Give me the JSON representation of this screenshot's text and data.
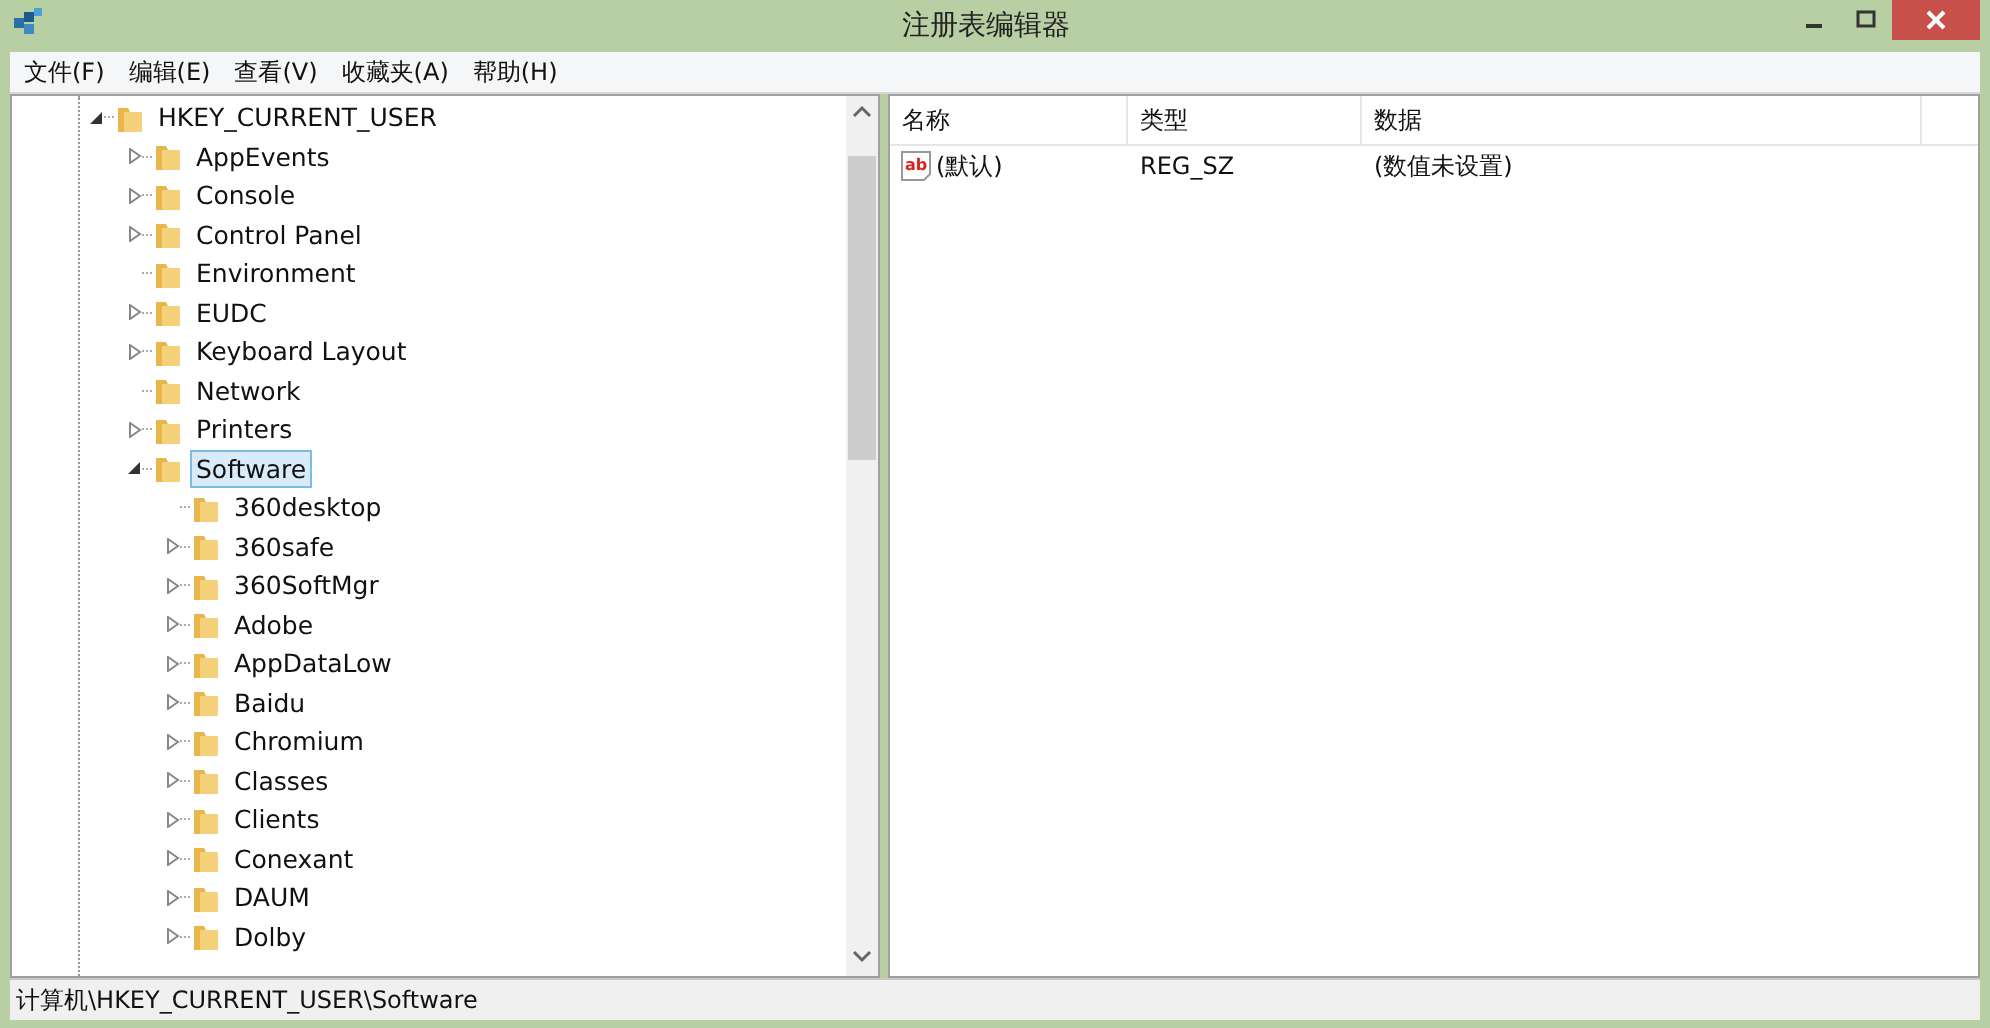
{
  "window": {
    "title": "注册表编辑器"
  },
  "menu": [
    "文件(F)",
    "编辑(E)",
    "查看(V)",
    "收藏夹(A)",
    "帮助(H)"
  ],
  "tree": [
    {
      "label": "HKEY_CURRENT_USER",
      "expanded": true,
      "selected": false,
      "children": [
        {
          "label": "AppEvents",
          "expanded": false,
          "selected": false
        },
        {
          "label": "Console",
          "expanded": false,
          "selected": false
        },
        {
          "label": "Control Panel",
          "expanded": false,
          "selected": false
        },
        {
          "label": "Environment",
          "selected": false
        },
        {
          "label": "EUDC",
          "expanded": false,
          "selected": false
        },
        {
          "label": "Keyboard Layout",
          "expanded": false,
          "selected": false
        },
        {
          "label": "Network",
          "selected": false
        },
        {
          "label": "Printers",
          "expanded": false,
          "selected": false
        },
        {
          "label": "Software",
          "expanded": true,
          "selected": true,
          "children": [
            {
              "label": "360desktop",
              "selected": false
            },
            {
              "label": "360safe",
              "expanded": false,
              "selected": false
            },
            {
              "label": "360SoftMgr",
              "expanded": false,
              "selected": false
            },
            {
              "label": "Adobe",
              "expanded": false,
              "selected": false
            },
            {
              "label": "AppDataLow",
              "expanded": false,
              "selected": false
            },
            {
              "label": "Baidu",
              "expanded": false,
              "selected": false
            },
            {
              "label": "Chromium",
              "expanded": false,
              "selected": false
            },
            {
              "label": "Classes",
              "expanded": false,
              "selected": false
            },
            {
              "label": "Clients",
              "expanded": false,
              "selected": false
            },
            {
              "label": "Conexant",
              "expanded": false,
              "selected": false
            },
            {
              "label": "DAUM",
              "expanded": false,
              "selected": false
            },
            {
              "label": "Dolby",
              "expanded": false,
              "selected": false
            }
          ]
        }
      ]
    }
  ],
  "values": {
    "columns": [
      "名称",
      "类型",
      "数据"
    ],
    "rows": [
      {
        "icon_label": "ab",
        "name": "(默认)",
        "type": "REG_SZ",
        "data": "(数值未设置)"
      }
    ]
  },
  "status_bar": "计算机\\HKEY_CURRENT_USER\\Software"
}
